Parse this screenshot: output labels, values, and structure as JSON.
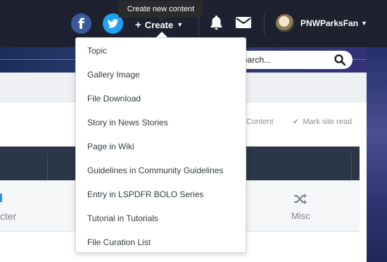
{
  "header": {
    "facebook_glyph": "f",
    "create_label": "Create",
    "plus_glyph": "+",
    "caret_glyph": "▼",
    "username": "PNWParksFan",
    "tooltip": "Create new content"
  },
  "search": {
    "placeholder": "earch..."
  },
  "actions": {
    "content": "Content",
    "mark_site_read": "Mark site read",
    "check_glyph": "✔"
  },
  "categories": {
    "left_label": "cter",
    "misc_label": "Misc"
  },
  "create_menu": {
    "items": [
      "Topic",
      "Gallery Image",
      "File Download",
      "Story in News Stories",
      "Page in Wiki",
      "Guidelines in Community Guidelines",
      "Entry in LSPDFR BOLO Series",
      "Tutorial in Tutorials",
      "File Curation List"
    ]
  },
  "colors": {
    "header_bg": "#1e2230",
    "facebook": "#3b5998",
    "twitter": "#1da1f2",
    "tabs_bg": "#2b3647"
  },
  "icons": [
    "facebook-icon",
    "twitter-icon",
    "bell-icon",
    "envelope-icon",
    "search-icon",
    "shuffle-icon",
    "check-icon"
  ]
}
